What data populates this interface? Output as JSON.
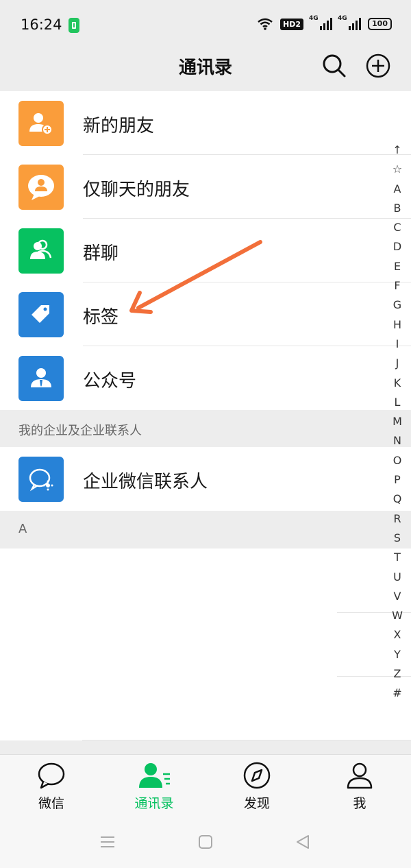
{
  "status": {
    "time": "16:24",
    "hd": "HD2",
    "net1": "4G",
    "net2": "4G",
    "battery": "100"
  },
  "header": {
    "title": "通讯录",
    "search_icon": "search-icon",
    "add_icon": "plus-circle-icon"
  },
  "menu": [
    {
      "label": "新的朋友",
      "icon": "add-friend-icon",
      "color": "#fa9d3b"
    },
    {
      "label": "仅聊天的朋友",
      "icon": "chat-only-icon",
      "color": "#fa9d3b"
    },
    {
      "label": "群聊",
      "icon": "group-icon",
      "color": "#07c160"
    },
    {
      "label": "标签",
      "icon": "tag-icon",
      "color": "#2782d7"
    },
    {
      "label": "公众号",
      "icon": "official-account-icon",
      "color": "#2782d7"
    }
  ],
  "enterprise": {
    "section_title": "我的企业及企业联系人",
    "item_label": "企业微信联系人",
    "item_icon": "wecom-icon",
    "item_color": "#2782d7"
  },
  "letter_section": {
    "title": "A"
  },
  "index": [
    "↑",
    "☆",
    "A",
    "B",
    "C",
    "D",
    "E",
    "F",
    "G",
    "H",
    "I",
    "J",
    "K",
    "L",
    "M",
    "N",
    "O",
    "P",
    "Q",
    "R",
    "S",
    "T",
    "U",
    "V",
    "W",
    "X",
    "Y",
    "Z",
    "#"
  ],
  "tabs": [
    {
      "label": "微信",
      "icon": "chat-bubble-icon",
      "active": false
    },
    {
      "label": "通讯录",
      "icon": "contacts-icon",
      "active": true
    },
    {
      "label": "发现",
      "icon": "compass-icon",
      "active": false
    },
    {
      "label": "我",
      "icon": "person-icon",
      "active": false
    }
  ],
  "colors": {
    "accent": "#07c160",
    "orange": "#fa9d3b",
    "blue": "#2782d7",
    "arrow": "#f26f3a"
  }
}
